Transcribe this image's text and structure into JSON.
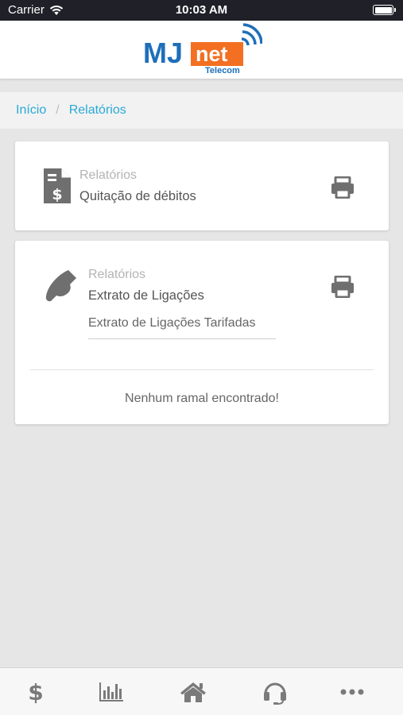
{
  "status_bar": {
    "carrier": "Carrier",
    "time": "10:03 AM"
  },
  "logo": {
    "mj": "MJ",
    "net": "net",
    "telecom": "Telecom"
  },
  "breadcrumb": {
    "items": [
      "Início",
      "Relatórios"
    ]
  },
  "cards": [
    {
      "category": "Relatórios",
      "title": "Quitação de débitos",
      "icon": "invoice-dollar-icon"
    },
    {
      "category": "Relatórios",
      "title": "Extrato de Ligações",
      "sub_option": "Extrato de Ligações Tarifadas",
      "empty_message": "Nenhum ramal encontrado!",
      "icon": "phone-icon"
    }
  ],
  "tab_bar": {
    "items": [
      "dollar-icon",
      "chart-icon",
      "home-icon",
      "headset-icon",
      "more-icon"
    ]
  },
  "colors": {
    "accent": "#29a9d6",
    "logo_blue": "#1e6fba",
    "logo_orange": "#f36f21",
    "icon_gray": "#6f6f6f"
  }
}
